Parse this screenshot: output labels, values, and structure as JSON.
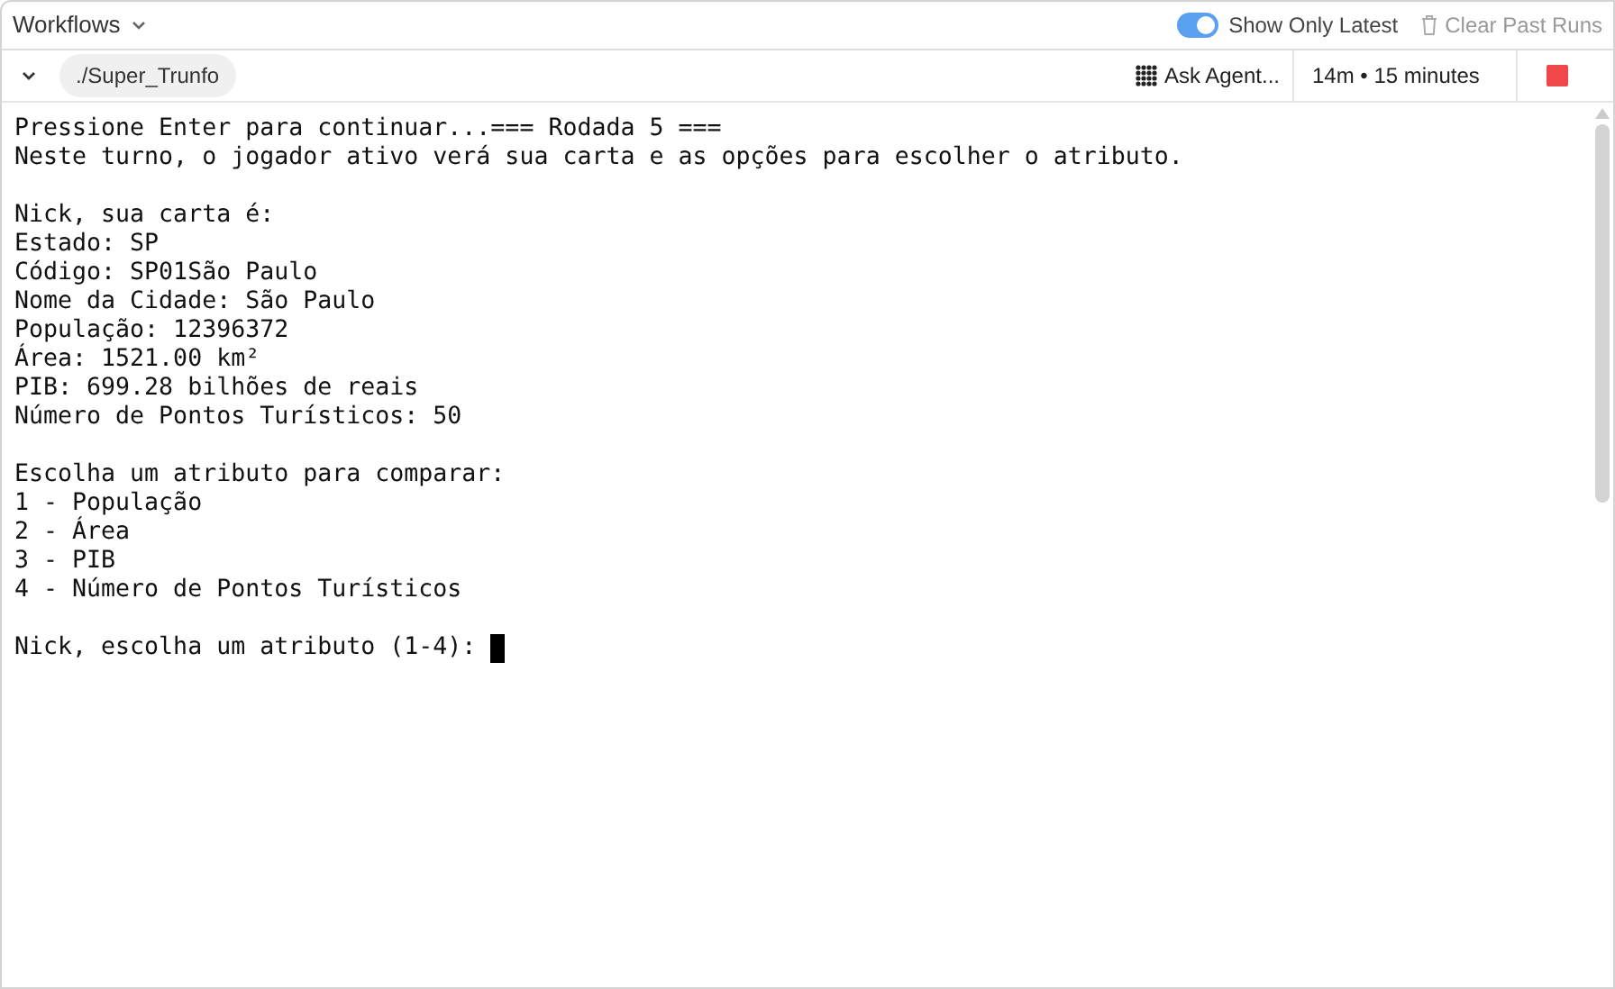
{
  "header": {
    "title": "Workflows",
    "toggle": {
      "label": "Show Only Latest",
      "on": true
    },
    "clear_button": {
      "label": "Clear Past Runs",
      "disabled": true
    }
  },
  "run_bar": {
    "expanded": true,
    "path": "./Super_Trunfo",
    "ask_agent": "Ask Agent...",
    "duration": "14m • 15 minutes"
  },
  "console": {
    "blocks": [
      [
        "Pressione Enter para continuar...=== Rodada 5 ===",
        "Neste turno, o jogador ativo verá sua carta e as opções para escolher o atributo."
      ],
      [
        "Nick, sua carta é:",
        "Estado: SP",
        "Código: SP01São Paulo",
        "Nome da Cidade: São Paulo",
        "População: 12396372",
        "Área: 1521.00 km²",
        "PIB: 699.28 bilhões de reais",
        "Número de Pontos Turísticos: 50"
      ],
      [
        "Escolha um atributo para comparar:",
        "1 - População",
        "2 - Área",
        "3 - PIB",
        "4 - Número de Pontos Turísticos"
      ],
      [
        "Nick, escolha um atributo (1-4): "
      ]
    ]
  }
}
